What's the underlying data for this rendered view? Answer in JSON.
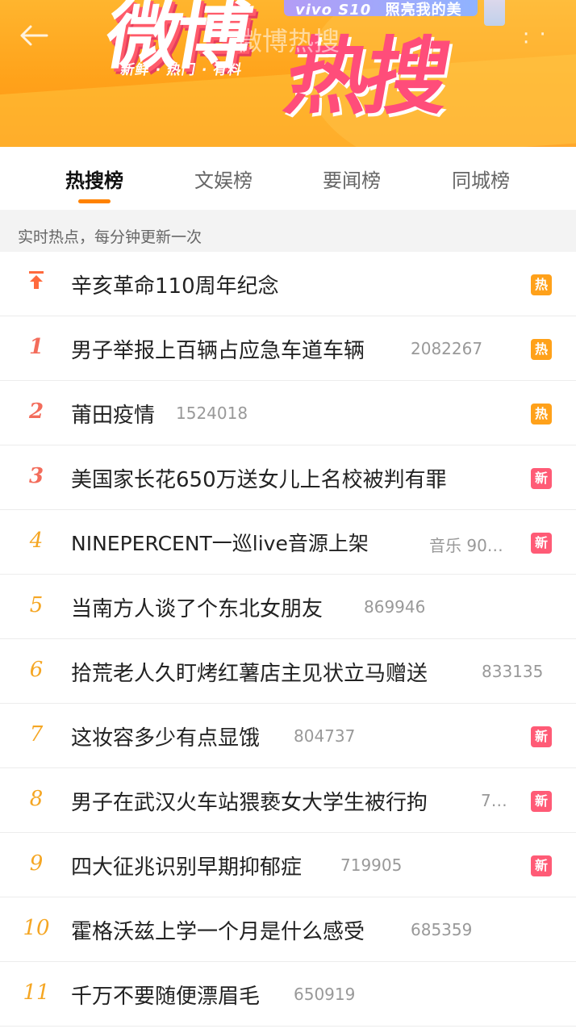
{
  "banner": {
    "art_line1": "微博",
    "art_line2": "热搜",
    "slogan": "新鲜 · 热门 · 有料",
    "ad_brand": "vivo S10",
    "ad_text": "照亮我的美"
  },
  "nav": {
    "title": "微博热搜",
    "more": "· · ·"
  },
  "tabs": [
    {
      "label": "热搜榜",
      "active": true
    },
    {
      "label": "文娱榜",
      "active": false
    },
    {
      "label": "要闻榜",
      "active": false
    },
    {
      "label": "同城榜",
      "active": false
    }
  ],
  "notice": "实时热点，每分钟更新一次",
  "items": [
    {
      "rank": "",
      "title": "辛亥革命110周年纪念",
      "heat": "",
      "badge": "热",
      "badge_type": "hot"
    },
    {
      "rank": "1",
      "title": "男子举报上百辆占应急车道车辆",
      "heat": "2082267",
      "badge": "热",
      "badge_type": "hot"
    },
    {
      "rank": "2",
      "title": "莆田疫情",
      "heat": "1524018",
      "badge": "热",
      "badge_type": "hot"
    },
    {
      "rank": "3",
      "title": "美国家长花650万送女儿上名校被判有罪",
      "heat": "",
      "badge": "新",
      "badge_type": "new"
    },
    {
      "rank": "4",
      "title": "NINEPERCENT一巡live音源上架",
      "heat": "音乐 90…",
      "badge": "新",
      "badge_type": "new"
    },
    {
      "rank": "5",
      "title": "当南方人谈了个东北女朋友",
      "heat": "869946",
      "badge": "",
      "badge_type": ""
    },
    {
      "rank": "6",
      "title": "拾荒老人久盯烤红薯店主见状立马赠送",
      "heat": "833135",
      "badge": "",
      "badge_type": ""
    },
    {
      "rank": "7",
      "title": "这妆容多少有点显饿",
      "heat": "804737",
      "badge": "新",
      "badge_type": "new"
    },
    {
      "rank": "8",
      "title": "男子在武汉火车站猥亵女大学生被行拘",
      "heat": "7…",
      "badge": "新",
      "badge_type": "new"
    },
    {
      "rank": "9",
      "title": "四大征兆识别早期抑郁症",
      "heat": "719905",
      "badge": "新",
      "badge_type": "new"
    },
    {
      "rank": "10",
      "title": "霍格沃兹上学一个月是什么感受",
      "heat": "685359",
      "badge": "",
      "badge_type": ""
    },
    {
      "rank": "11",
      "title": "千万不要随便漂眉毛",
      "heat": "650919",
      "badge": "",
      "badge_type": ""
    }
  ],
  "colors": {
    "accent": "#ff8200",
    "hot_badge": "#ffa11a",
    "new_badge": "#ff5b76",
    "rank_top3": "#f36c5b",
    "rank_rest": "#f5a623"
  }
}
